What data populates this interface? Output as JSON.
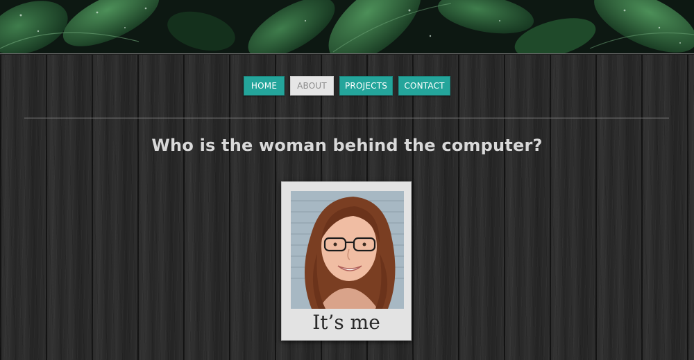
{
  "nav": {
    "items": [
      {
        "label": "HOME",
        "active": false
      },
      {
        "label": "ABOUT",
        "active": true
      },
      {
        "label": "PROJECTS",
        "active": false
      },
      {
        "label": "CONTACT",
        "active": false
      }
    ]
  },
  "main": {
    "heading": "Who is the woman behind the computer?",
    "photo_caption": "It’s me"
  },
  "colors": {
    "accent": "#24a59b",
    "active_tab": "#e6e6e6",
    "heading_text": "#d9d9d9"
  },
  "icons": {
    "banner": "leaves-banner-image",
    "portrait": "portrait-photo"
  }
}
